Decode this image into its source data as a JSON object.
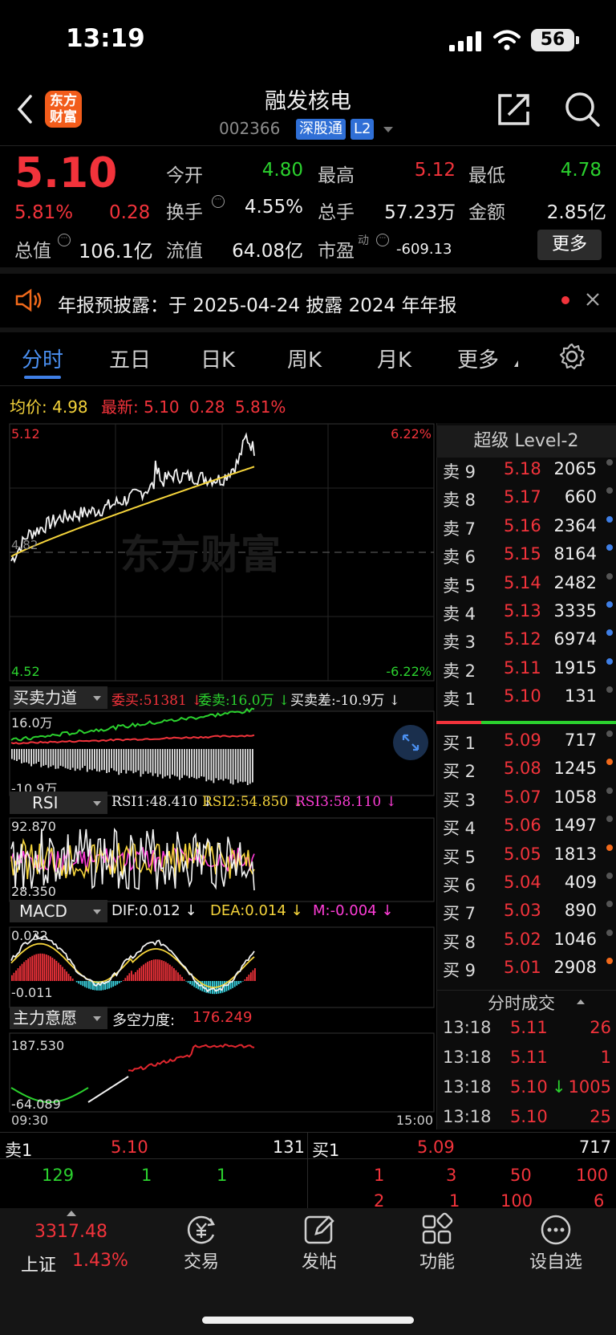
{
  "status": {
    "time": "13:19",
    "battery": "56"
  },
  "header": {
    "name": "融发核电",
    "code": "002366",
    "tag1": "深股通",
    "tag2": "L2",
    "logo_line1": "东方",
    "logo_line2": "财富"
  },
  "quote": {
    "price": "5.10",
    "pct": "5.81%",
    "chg": "0.28",
    "open_label": "今开",
    "open": "4.80",
    "high_label": "最高",
    "high": "5.12",
    "low_label": "最低",
    "low": "4.78",
    "turnover_label": "换手",
    "turnover": "4.55%",
    "volume_label": "总手",
    "volume": "57.23万",
    "amount_label": "金额",
    "amount": "2.85亿",
    "mcap_label": "总值",
    "mcap": "106.1亿",
    "float_label": "流值",
    "float": "64.08亿",
    "pe_label": "市盈",
    "pe_sup": "动",
    "pe": "-609.13",
    "more": "更多"
  },
  "notice": {
    "text": "年报预披露：于 2025-04-24 披露 2024 年年报"
  },
  "tabs": [
    "分时",
    "五日",
    "日K",
    "周K",
    "月K",
    "更多"
  ],
  "intraday": {
    "avg_label": "均价:",
    "avg": "4.98",
    "latest_label": "最新:",
    "latest": "5.10",
    "chg": "0.28",
    "pct": "5.81%",
    "top_price": "5.12",
    "bottom_price": "4.52",
    "top_pct": "6.22%",
    "bottom_pct": "-6.22%",
    "ref_price": "4.82",
    "watermark": "东方财富",
    "time_start": "09:30",
    "time_end": "15:00"
  },
  "panel1": {
    "label": "买卖力道",
    "buy_label": "委买:",
    "buy": "51381",
    "sell_label": "委卖:",
    "sell": "16.0万",
    "diff_label": "买卖差:",
    "diff": "-10.9万",
    "y_top": "16.0万",
    "y_bottom": "-10.9万"
  },
  "panel2": {
    "label": "RSI",
    "rsi1": "RSI1:48.410",
    "rsi2": "RSI2:54.850",
    "rsi3": "RSI3:58.110",
    "y_top": "92.870",
    "y_bottom": "28.350"
  },
  "panel3": {
    "label": "MACD",
    "dif": "DIF:0.012",
    "dea": "DEA:0.014",
    "m": "M:-0.004",
    "y_top": "0.032",
    "y_bottom": "-0.011"
  },
  "panel4": {
    "label": "主力意愿",
    "force_label": "多空力度:",
    "force": "176.249",
    "y_top": "187.530",
    "y_bottom": "-64.089"
  },
  "orderbook": {
    "title": "超级 Level-2",
    "sells": [
      {
        "label": "卖 9",
        "price": "5.18",
        "vol": "2065",
        "dot": "#555555"
      },
      {
        "label": "卖 8",
        "price": "5.17",
        "vol": "660",
        "dot": "#555555"
      },
      {
        "label": "卖 7",
        "price": "5.16",
        "vol": "2364",
        "dot": "#3f7fe6"
      },
      {
        "label": "卖 6",
        "price": "5.15",
        "vol": "8164",
        "dot": "#3f7fe6"
      },
      {
        "label": "卖 5",
        "price": "5.14",
        "vol": "2482",
        "dot": "#555555"
      },
      {
        "label": "卖 4",
        "price": "5.13",
        "vol": "3335",
        "dot": "#3f7fe6"
      },
      {
        "label": "卖 3",
        "price": "5.12",
        "vol": "6974",
        "dot": "#3f7fe6"
      },
      {
        "label": "卖 2",
        "price": "5.11",
        "vol": "1915",
        "dot": "#3f7fe6"
      },
      {
        "label": "卖 1",
        "price": "5.10",
        "vol": "131",
        "dot": "#555555"
      }
    ],
    "buys": [
      {
        "label": "买 1",
        "price": "5.09",
        "vol": "717",
        "dot": "#555555"
      },
      {
        "label": "买 2",
        "price": "5.08",
        "vol": "1245",
        "dot": "#f26a1b"
      },
      {
        "label": "买 3",
        "price": "5.07",
        "vol": "1058",
        "dot": "#555555"
      },
      {
        "label": "买 4",
        "price": "5.06",
        "vol": "1497",
        "dot": "#555555"
      },
      {
        "label": "买 5",
        "price": "5.05",
        "vol": "1813",
        "dot": "#f26a1b"
      },
      {
        "label": "买 6",
        "price": "5.04",
        "vol": "409",
        "dot": "#555555"
      },
      {
        "label": "买 7",
        "price": "5.03",
        "vol": "890",
        "dot": "#555555"
      },
      {
        "label": "买 8",
        "price": "5.02",
        "vol": "1046",
        "dot": "#555555"
      },
      {
        "label": "买 9",
        "price": "5.01",
        "vol": "2908",
        "dot": "#f26a1b"
      }
    ]
  },
  "trades": {
    "title": "分时成交",
    "rows": [
      {
        "time": "13:18",
        "price": "5.11",
        "vol": "26",
        "arrow": ""
      },
      {
        "time": "13:18",
        "price": "5.11",
        "vol": "1",
        "arrow": ""
      },
      {
        "time": "13:18",
        "price": "5.10",
        "vol": "1005",
        "arrow": "↓"
      },
      {
        "time": "13:18",
        "price": "5.10",
        "vol": "25",
        "arrow": ""
      }
    ]
  },
  "queue": {
    "sell_label": "卖1",
    "sell_price": "5.10",
    "sell_vol": "131",
    "buy_label": "买1",
    "buy_price": "5.09",
    "buy_vol": "717",
    "sell_items": [
      "129",
      "1",
      "1"
    ],
    "buy_items": [
      "1",
      "3",
      "50",
      "100"
    ],
    "buy_items2": [
      "2",
      "1",
      "100",
      "6"
    ]
  },
  "bottom": {
    "index_value": "3317.48",
    "index_name": "上证",
    "index_pct": "1.43%",
    "nav": [
      "交易",
      "发帖",
      "功能",
      "设自选"
    ]
  }
}
